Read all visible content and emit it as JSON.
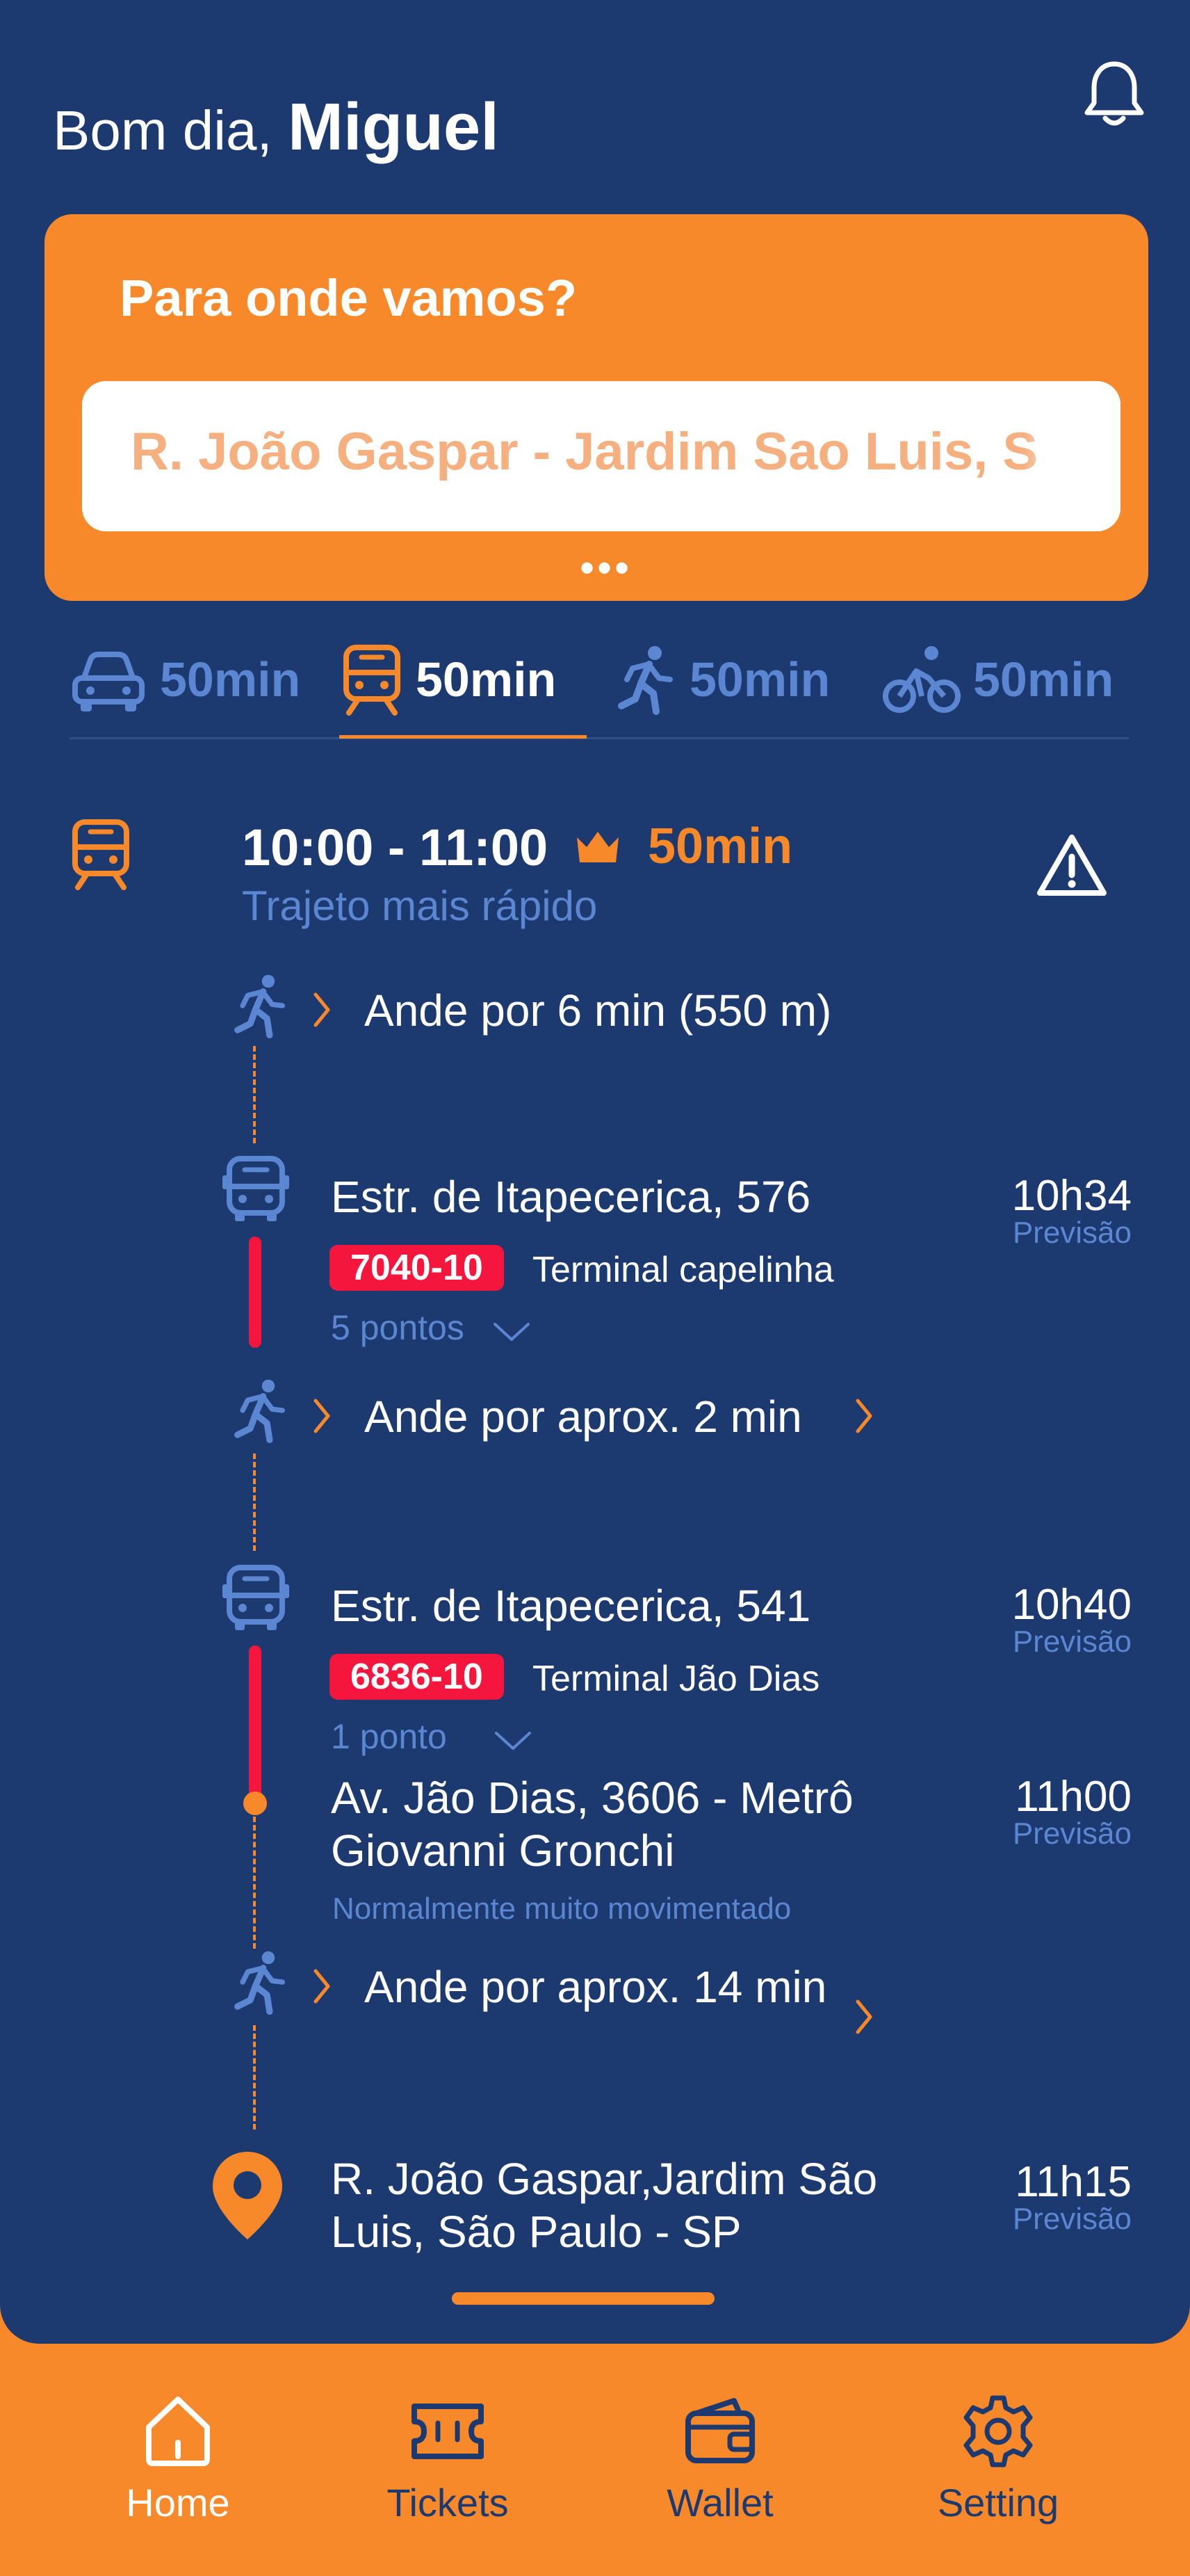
{
  "header": {
    "greeting": "Bom dia,",
    "user_name": "Miguel"
  },
  "destination_card": {
    "title": "Para onde vamos?",
    "search_value": "R. João Gaspar - Jardim Sao Luis, S",
    "more": "•••"
  },
  "modes": [
    {
      "icon": "car-icon",
      "label": "50min",
      "active": false
    },
    {
      "icon": "train-icon",
      "label": "50min",
      "active": true
    },
    {
      "icon": "walk-icon",
      "label": "50min",
      "active": false
    },
    {
      "icon": "bike-icon",
      "label": "50min",
      "active": false
    }
  ],
  "route": {
    "time_range": "10:00 - 11:00",
    "duration": "50min",
    "subtitle": "Trajeto mais rápido",
    "walk1": "Ande por 6 min (550 m)",
    "stop1": {
      "title": "Estr. de Itapecerica, 576",
      "time": "10h34",
      "time_label": "Previsão",
      "line": "7040-10",
      "terminal": "Terminal capelinha",
      "stops": "5 pontos"
    },
    "walk2": "Ande por aprox. 2 min",
    "stop2": {
      "title": "Estr. de Itapecerica, 541",
      "time": "10h40",
      "time_label": "Previsão",
      "line": "6836-10",
      "terminal": "Terminal Jão Dias",
      "stops": "1 ponto"
    },
    "stop3": {
      "title_line1": "Av. Jão Dias, 3606 - Metrô",
      "title_line2": "Giovanni Gronchi",
      "time": "11h00",
      "time_label": "Previsão",
      "note": "Normalmente muito movimentado"
    },
    "walk3": "Ande por aprox. 14 min",
    "destination": {
      "line1": "R. João Gaspar,Jardim São",
      "line2": "Luis, São Paulo - SP",
      "time": "11h15",
      "time_label": "Previsão"
    }
  },
  "nav": [
    {
      "icon": "home-icon",
      "label": "Home",
      "active": true
    },
    {
      "icon": "ticket-icon",
      "label": "Tickets",
      "active": false
    },
    {
      "icon": "wallet-icon",
      "label": "Wallet",
      "active": false
    },
    {
      "icon": "settings-icon",
      "label": "Setting",
      "active": false
    }
  ],
  "colors": {
    "background": "#1C3A70",
    "accent": "#F7892A",
    "line_badge": "#F5163E",
    "muted_blue": "#5A86D2"
  }
}
